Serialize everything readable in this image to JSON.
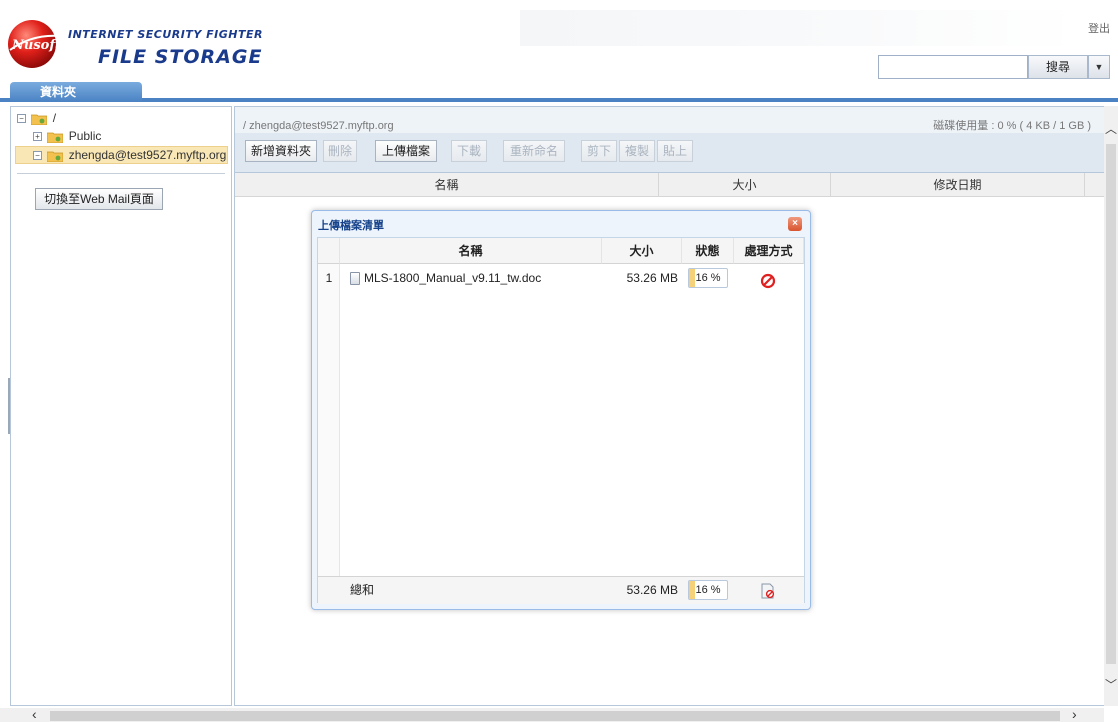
{
  "header": {
    "brand_line1": "INTERNET SECURITY FIGHTER",
    "brand_line2": "FILE STORAGE",
    "logo_text": "Nusoft",
    "logout": "登出",
    "search_button": "搜尋"
  },
  "tabs": [
    {
      "label": "資料夾"
    }
  ],
  "tree": {
    "root_label": "/",
    "items": [
      {
        "label": "Public"
      },
      {
        "label": "zhengda@test9527.myftp.org",
        "selected": true
      }
    ],
    "switch_button": "切換至Web Mail頁面"
  },
  "main": {
    "path": "/ zhengda@test9527.myftp.org",
    "disk_usage": "磁碟使用量 : 0 % ( 4 KB / 1 GB )",
    "toolbar": {
      "new_folder": "新增資料夾",
      "delete": "刪除",
      "upload": "上傳檔案",
      "download": "下載",
      "rename": "重新命名",
      "cut": "剪下",
      "copy": "複製",
      "paste": "貼上"
    },
    "columns": [
      "名稱",
      "大小",
      "修改日期"
    ]
  },
  "dialog": {
    "title": "上傳檔案清單",
    "columns": {
      "name": "名稱",
      "size": "大小",
      "status": "狀態",
      "action": "處理方式"
    },
    "rows": [
      {
        "index": "1",
        "name": "MLS-1800_Manual_v9.11_tw.doc",
        "size": "53.26 MB",
        "status": "16 %",
        "progress": 0.16
      }
    ],
    "footer": {
      "label": "總和",
      "size": "53.26 MB",
      "status": "16 %",
      "progress": 0.16
    }
  },
  "colors": {
    "accent": "#4a82c3",
    "brand": "#1a3a8c",
    "selection": "#f9e7b6",
    "progress_fill": "#f5d27a",
    "cancel_red": "#e02020"
  }
}
